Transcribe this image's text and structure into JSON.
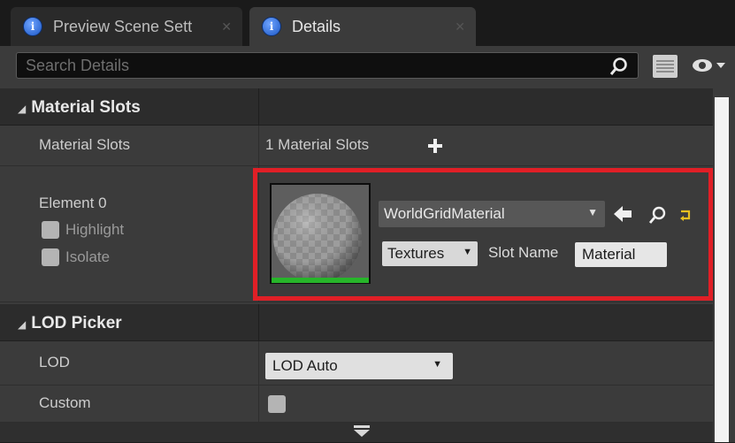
{
  "tabs": [
    {
      "label": "Preview Scene Sett",
      "active": false
    },
    {
      "label": "Details",
      "active": true
    }
  ],
  "search": {
    "placeholder": "Search Details"
  },
  "categories": {
    "material_slots": "Material Slots",
    "lod_picker": "LOD Picker"
  },
  "material_slots": {
    "row_label": "Material Slots",
    "count_text": "1 Material Slots",
    "element": {
      "label": "Element 0",
      "highlight": "Highlight",
      "isolate": "Isolate",
      "material_name": "WorldGridMaterial",
      "textures_label": "Textures",
      "slot_name_label": "Slot Name",
      "slot_name_value": "Material"
    }
  },
  "lod": {
    "lod_label": "LOD",
    "lod_value": "LOD Auto",
    "custom_label": "Custom"
  },
  "colors": {
    "highlight_box": "#e01f26",
    "thumbnail_bar": "#27b52a",
    "tab_icon": "#1b57c6"
  }
}
